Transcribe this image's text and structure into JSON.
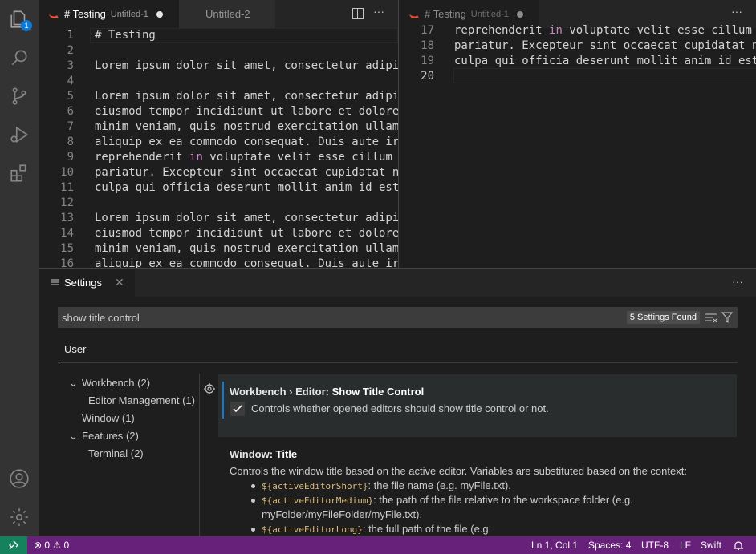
{
  "activity": {
    "badge": "1"
  },
  "editor_left": {
    "tab1_title": "# Testing",
    "tab1_desc": "Untitled-1",
    "tab2_title": "Untitled-2",
    "lines": [
      {
        "n": "1",
        "t": "# Testing"
      },
      {
        "n": "2",
        "t": ""
      },
      {
        "n": "3",
        "t": "Lorem ipsum dolor sit amet, consectetur adipi"
      },
      {
        "n": "4",
        "t": ""
      },
      {
        "n": "5",
        "t": "Lorem ipsum dolor sit amet, consectetur adipi"
      },
      {
        "n": "6",
        "t": "eiusmod tempor incididunt ut labore et dolore"
      },
      {
        "n": "7",
        "t": "minim veniam, quis nostrud exercitation ullam"
      },
      {
        "n": "8",
        "t": "aliquip ex ea commodo consequat. Duis aute ir"
      },
      {
        "n": "9",
        "t": "reprehenderit ",
        "kw": "in",
        "rest": " voluptate velit esse cillum"
      },
      {
        "n": "10",
        "t": "pariatur. Excepteur sint occaecat cupidatat n"
      },
      {
        "n": "11",
        "t": "culpa qui officia deserunt mollit anim id est"
      },
      {
        "n": "12",
        "t": ""
      },
      {
        "n": "13",
        "t": "Lorem ipsum dolor sit amet, consectetur adipi"
      },
      {
        "n": "14",
        "t": "eiusmod tempor incididunt ut labore et dolore"
      },
      {
        "n": "15",
        "t": "minim veniam, quis nostrud exercitation ullam"
      },
      {
        "n": "16",
        "t": "aliquip ex ea commodo consequat. Duis aute ir"
      }
    ]
  },
  "editor_right": {
    "tab1_title": "# Testing",
    "tab1_desc": "Untitled-1",
    "lines": [
      {
        "n": "17",
        "t": "reprehenderit ",
        "kw": "in",
        "rest": " voluptate velit esse cillum"
      },
      {
        "n": "18",
        "t": "pariatur. Excepteur sint occaecat cupidatat n"
      },
      {
        "n": "19",
        "t": "culpa qui officia deserunt mollit anim id est"
      },
      {
        "n": "20",
        "t": ""
      }
    ]
  },
  "settings": {
    "tab_label": "Settings",
    "search_value": "show title control",
    "found": "5 Settings Found",
    "scope_tab": "User",
    "toc": [
      {
        "label": "Workbench",
        "count": "(2)"
      },
      {
        "label": "Editor Management",
        "count": "(1)"
      },
      {
        "label": "Window",
        "count": "(1)"
      },
      {
        "label": "Features",
        "count": "(2)"
      },
      {
        "label": "Terminal",
        "count": "(2)"
      }
    ],
    "s1_category": "Workbench › Editor: ",
    "s1_name": "Show Title Control",
    "s1_desc": "Controls whether opened editors should show title control or not.",
    "s2_category": "Window: ",
    "s2_name": "Title",
    "s2_desc": "Controls the window title based on the active editor. Variables are substituted based on the context:",
    "bullets": [
      {
        "code": "${activeEditorShort}",
        "text": ": the file name (e.g. myFile.txt)."
      },
      {
        "code": "${activeEditorMedium}",
        "text": ": the path of the file relative to the workspace folder (e.g."
      },
      {
        "code": "",
        "text": "myFolder/myFileFolder/myFile.txt)."
      },
      {
        "code": "${activeEditorLong}",
        "text": ": the full path of the file (e.g."
      }
    ]
  },
  "status": {
    "problems": "0",
    "warnings": "0",
    "position": "Ln 1, Col 1",
    "spaces": "Spaces: 4",
    "encoding": "UTF-8",
    "eol": "LF",
    "language": "Swift"
  },
  "colors": {
    "accent": "#0e7ad3",
    "status_bar": "#68217a",
    "remote": "#16825d",
    "swift": "#f05138"
  }
}
